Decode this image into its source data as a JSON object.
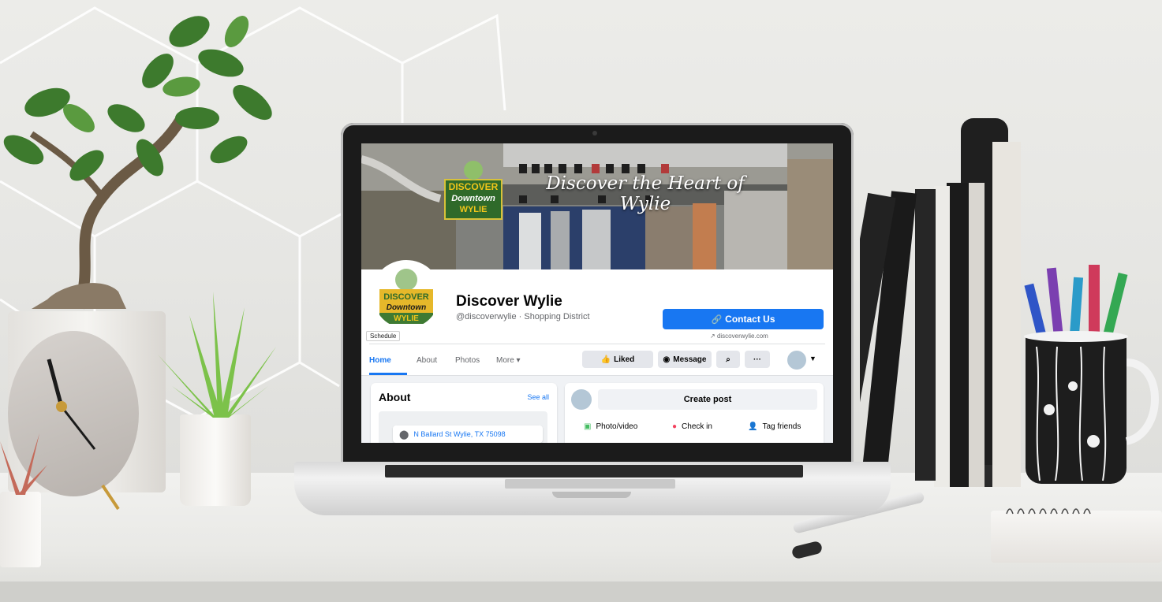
{
  "cover": {
    "tagline": "Discover the Heart of Wylie",
    "logo_line1": "DISCOVER",
    "logo_line2": "Downtown",
    "logo_line3": "WYLIE"
  },
  "page": {
    "name": "Discover Wylie",
    "subtitle": "@discoverwylie · Shopping District",
    "schedule_label": "Schedule"
  },
  "actions": {
    "contact_label": "Contact Us",
    "website": "discoverwylie.com"
  },
  "nav": {
    "tabs": [
      {
        "label": "Home"
      },
      {
        "label": "About"
      },
      {
        "label": "Photos"
      },
      {
        "label": "More ▾"
      }
    ],
    "liked_label": "Liked",
    "message_label": "Message"
  },
  "about_card": {
    "title": "About",
    "see_all": "See all",
    "address": "N Ballard St Wylie, TX 75098"
  },
  "post_card": {
    "create_post": "Create post",
    "photo_video": "Photo/video",
    "check_in": "Check in",
    "tag_friends": "Tag friends"
  },
  "colors": {
    "facebook_blue": "#1877f2",
    "page_background": "#f0f2f5"
  }
}
